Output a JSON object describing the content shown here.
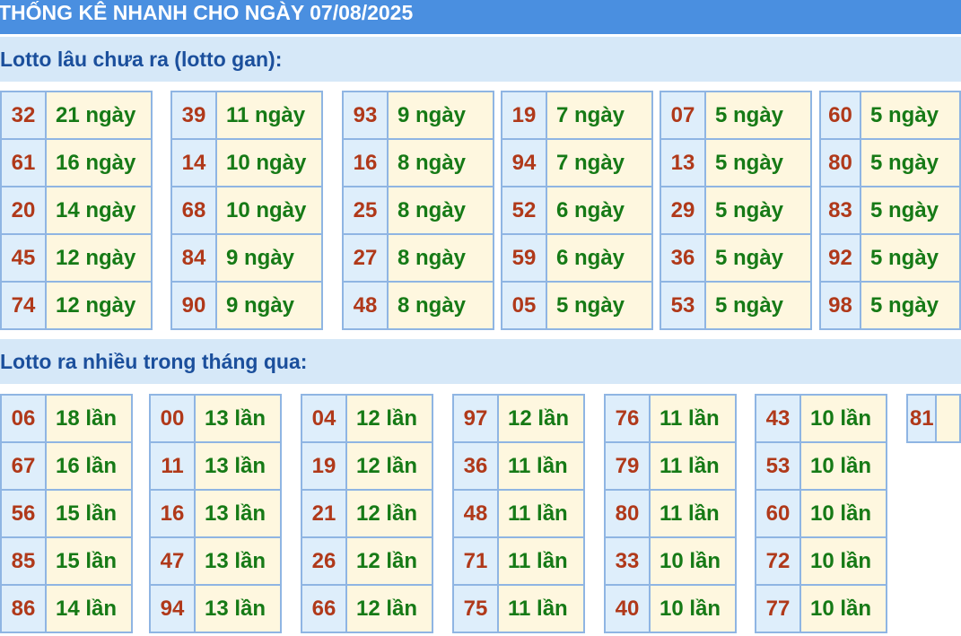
{
  "header": {
    "title": "THỐNG KÊ NHANH CHO NGÀY 07/08/2025"
  },
  "sections": {
    "gan": {
      "title": "Lotto lâu chưa ra (lotto gan):",
      "tables": [
        [
          [
            "32",
            "21 ngày"
          ],
          [
            "61",
            "16 ngày"
          ],
          [
            "20",
            "14 ngày"
          ],
          [
            "45",
            "12 ngày"
          ],
          [
            "74",
            "12 ngày"
          ]
        ],
        [
          [
            "39",
            "11 ngày"
          ],
          [
            "14",
            "10 ngày"
          ],
          [
            "68",
            "10 ngày"
          ],
          [
            "84",
            "9 ngày"
          ],
          [
            "90",
            "9 ngày"
          ]
        ],
        [
          [
            "93",
            "9 ngày"
          ],
          [
            "16",
            "8 ngày"
          ],
          [
            "25",
            "8 ngày"
          ],
          [
            "27",
            "8 ngày"
          ],
          [
            "48",
            "8 ngày"
          ]
        ],
        [
          [
            "19",
            "7 ngày"
          ],
          [
            "94",
            "7 ngày"
          ],
          [
            "52",
            "6 ngày"
          ],
          [
            "59",
            "6 ngày"
          ],
          [
            "05",
            "5 ngày"
          ]
        ],
        [
          [
            "07",
            "5 ngày"
          ],
          [
            "13",
            "5 ngày"
          ],
          [
            "29",
            "5 ngày"
          ],
          [
            "36",
            "5 ngày"
          ],
          [
            "53",
            "5 ngày"
          ]
        ],
        [
          [
            "60",
            "5 ngày"
          ],
          [
            "80",
            "5 ngày"
          ],
          [
            "83",
            "5 ngày"
          ],
          [
            "92",
            "5 ngày"
          ],
          [
            "98",
            "5 ngày"
          ]
        ]
      ]
    },
    "nhieu": {
      "title": "Lotto ra nhiều trong tháng qua:",
      "tables": [
        [
          [
            "06",
            "18 lần"
          ],
          [
            "67",
            "16 lần"
          ],
          [
            "56",
            "15 lần"
          ],
          [
            "85",
            "15 lần"
          ],
          [
            "86",
            "14 lần"
          ]
        ],
        [
          [
            "00",
            "13 lần"
          ],
          [
            "11",
            "13 lần"
          ],
          [
            "16",
            "13 lần"
          ],
          [
            "47",
            "13 lần"
          ],
          [
            "94",
            "13 lần"
          ]
        ],
        [
          [
            "04",
            "12 lần"
          ],
          [
            "19",
            "12 lần"
          ],
          [
            "21",
            "12 lần"
          ],
          [
            "26",
            "12 lần"
          ],
          [
            "66",
            "12 lần"
          ]
        ],
        [
          [
            "97",
            "12 lần"
          ],
          [
            "36",
            "11 lần"
          ],
          [
            "48",
            "11 lần"
          ],
          [
            "71",
            "11 lần"
          ],
          [
            "75",
            "11 lần"
          ]
        ],
        [
          [
            "76",
            "11 lần"
          ],
          [
            "79",
            "11 lần"
          ],
          [
            "80",
            "11 lần"
          ],
          [
            "33",
            "10 lần"
          ],
          [
            "40",
            "10 lần"
          ]
        ],
        [
          [
            "43",
            "10 lần"
          ],
          [
            "53",
            "10 lần"
          ],
          [
            "60",
            "10 lần"
          ],
          [
            "72",
            "10 lần"
          ],
          [
            "77",
            "10 lần"
          ]
        ],
        [
          [
            "81",
            ""
          ]
        ]
      ]
    }
  }
}
